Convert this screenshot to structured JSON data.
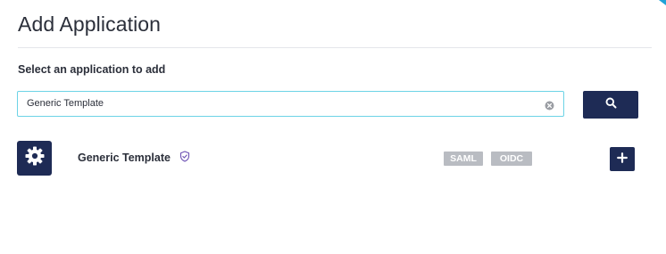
{
  "header": {
    "title": "Add Application"
  },
  "search": {
    "label": "Select an application to add",
    "value": "Generic Template",
    "clear_icon": "clear-circle-icon",
    "button_icon": "search-icon"
  },
  "results": [
    {
      "name": "Generic Template",
      "icon": "gear-icon",
      "verified_icon": "shield-check-icon",
      "badges": [
        "SAML",
        "OIDC"
      ],
      "action_icon": "plus-icon"
    }
  ],
  "colors": {
    "primary": "#1e2b55",
    "input_focus_border": "#6cd3e6",
    "badge_bg": "#b9bcc2",
    "verified": "#6b4fb3"
  }
}
